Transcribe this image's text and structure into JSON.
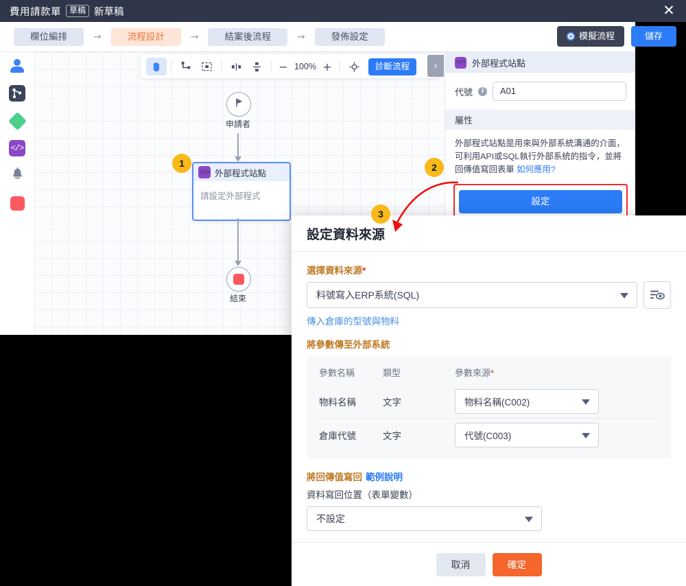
{
  "titlebar": {
    "title": "費用請款單",
    "chip": "草稿",
    "subtitle": "新草稿",
    "close_icon": "close-icon"
  },
  "steps": {
    "items": [
      {
        "label": "欄位編排",
        "active": false
      },
      {
        "label": "流程設計",
        "active": true
      },
      {
        "label": "結案後流程",
        "active": false
      },
      {
        "label": "發佈設定",
        "active": false
      }
    ],
    "arrow": "→",
    "simulate_label": "模擬流程",
    "save_label": "儲存"
  },
  "sidebar": {
    "items": [
      {
        "name": "person-icon",
        "label": "申請人節點"
      },
      {
        "name": "flow-icon",
        "label": "流程節點"
      },
      {
        "name": "diamond-icon",
        "label": "條件節點"
      },
      {
        "name": "code-icon",
        "label": "外部程式節點"
      },
      {
        "name": "bell-icon",
        "label": "通知節點"
      },
      {
        "name": "stop-icon",
        "label": "結束節點"
      }
    ]
  },
  "toolbar": {
    "hand_tool": "hand-icon",
    "connector_tool": "connector-icon",
    "frame_tool": "frame-icon",
    "align_h_tool": "align-horizontal-icon",
    "align_v_tool": "align-vertical-icon",
    "zoom_out": "−",
    "zoom_level": "100%",
    "zoom_in": "+",
    "fit_tool": "fit-icon",
    "diagnose_label": "診斷流程",
    "panel_toggle": "›"
  },
  "canvas": {
    "start_node": {
      "label": "申請者",
      "icon": "flag-icon"
    },
    "ext_node": {
      "title": "外部程式站點",
      "body": "請設定外部程式",
      "icon": "code-icon"
    },
    "end_node": {
      "label": "結束",
      "icon": "stop-icon"
    }
  },
  "panel": {
    "header_title": "外部程式站點",
    "code_label": "代號",
    "code_value": "A01",
    "info_icon": "info-icon",
    "section_title": "屬性",
    "description": "外部程式站點是用來與外部系統溝通的介面，可利用API或SQL執行外部系統的指令，並將回傳值寫回表單",
    "desc_link": "如何應用?",
    "setting_label": "設定"
  },
  "badges": [
    {
      "number": "1"
    },
    {
      "number": "2"
    },
    {
      "number": "3"
    }
  ],
  "modal": {
    "title": "設定資料來源",
    "source_label": "選擇資料來源",
    "required_mark": "*",
    "source_value": "料號寫入ERP系統(SQL)",
    "sql_preview_icon": "sql-preview-icon",
    "source_hint": "傳入倉庫的型號與物料",
    "params_title": "將參數傳至外部系統",
    "params_headers": [
      "參數名稱",
      "類型",
      "參數來源"
    ],
    "params_required_mark": "*",
    "params_rows": [
      {
        "name": "物料名稱",
        "type": "文字",
        "source": "物料名稱(C002)"
      },
      {
        "name": "倉庫代號",
        "type": "文字",
        "source": "代號(C003)"
      }
    ],
    "writeback_title": "將回傳值寫回",
    "writeback_link": "範例說明",
    "writeback_sublabel": "資料寫回位置（表單變數）",
    "writeback_value": "不設定",
    "cancel_label": "取消",
    "confirm_label": "確定"
  },
  "colors": {
    "accent_blue": "#2b7cf6",
    "accent_orange": "#f4662c",
    "step_active_bg": "#fde5d8",
    "step_active_text": "#f2763b",
    "badge_bg": "#f8b919",
    "highlight_red": "#ef2b2b",
    "titlebar_bg": "#2f3649",
    "label_orange": "#c07a26"
  }
}
